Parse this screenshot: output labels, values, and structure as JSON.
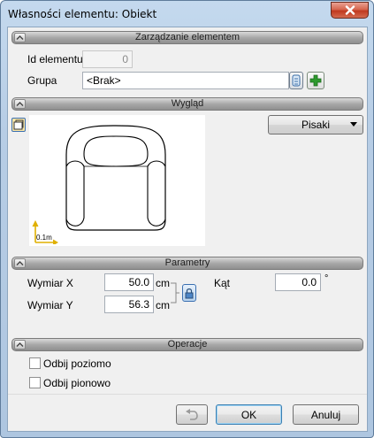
{
  "window": {
    "title": "Własności elementu: Obiekt"
  },
  "sections": {
    "management": "Zarządzanie elementem",
    "appearance": "Wygląd",
    "parameters": "Parametry",
    "operations": "Operacje"
  },
  "management": {
    "id_label": "Id elementu",
    "id_value": "0",
    "group_label": "Grupa",
    "group_value": "<Brak>"
  },
  "appearance": {
    "pens_button": "Pisaki",
    "scale_label": "0.1m"
  },
  "parameters": {
    "size_x_label": "Wymiar X",
    "size_x_value": "50.0",
    "size_x_unit": "cm",
    "size_y_label": "Wymiar Y",
    "size_y_value": "56.3",
    "size_y_unit": "cm",
    "angle_label": "Kąt",
    "angle_value": "0.0",
    "angle_unit": "°"
  },
  "operations": {
    "flip_horizontal": "Odbij poziomo",
    "flip_horizontal_checked": false,
    "flip_vertical": "Odbij pionowo",
    "flip_vertical_checked": false
  },
  "footer": {
    "ok": "OK",
    "cancel": "Anuluj"
  },
  "colors": {
    "titlebar": "#b7cde5",
    "close": "#c0391f",
    "section_header": "#a8a8a8",
    "plus_icon": "#2e9a2e",
    "scale_arrow": "#e0b000"
  },
  "icons": {
    "close": "close-icon",
    "group_picker": "list-picker-icon",
    "add_group": "plus-icon",
    "preview_mode": "preview-mode-icon",
    "pens_dropdown": "chevron-down-icon",
    "proportion_lock": "lock-icon",
    "undo": "undo-icon",
    "section_collapse": "chevron-up-icon"
  }
}
